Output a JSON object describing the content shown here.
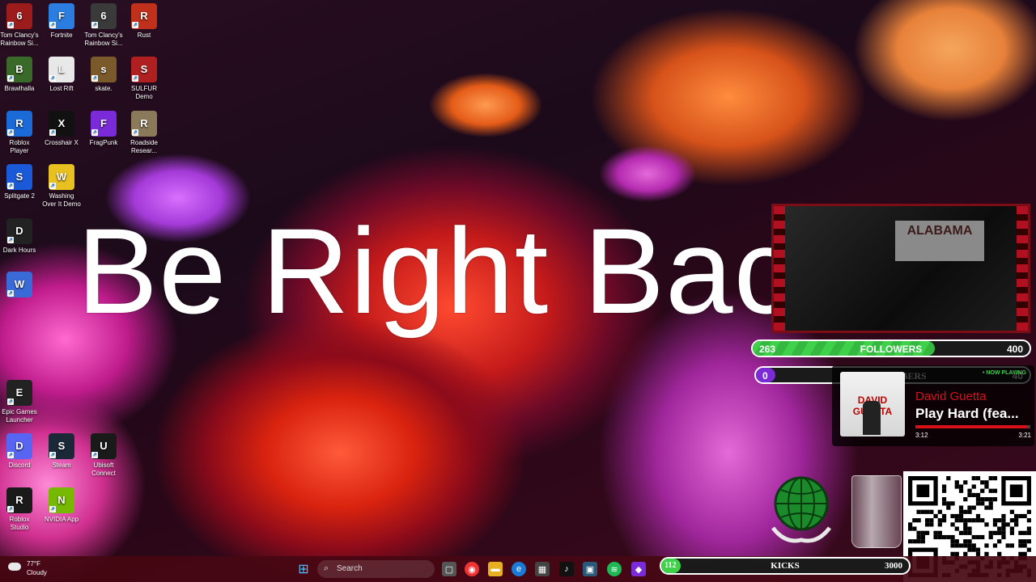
{
  "desktop_icons": [
    {
      "label": "Tom Clancy's Rainbow Si...",
      "glyph": "6",
      "color": "#9c1b1b",
      "icon": "rainbow-six-icon"
    },
    {
      "label": "Fortnite",
      "glyph": "F",
      "color": "#2b7de0",
      "icon": "fortnite-icon"
    },
    {
      "label": "Tom Clancy's Rainbow Si...",
      "glyph": "6",
      "color": "#3a3a3a",
      "icon": "rainbow-six-icon"
    },
    {
      "label": "Rust",
      "glyph": "R",
      "color": "#c0301a",
      "icon": "rust-icon"
    },
    {
      "label": "Brawlhalla",
      "glyph": "B",
      "color": "#3a6a2a",
      "icon": "brawlhalla-icon"
    },
    {
      "label": "Lost Rift",
      "glyph": "L",
      "color": "#e8e8e8",
      "icon": "lost-rift-icon"
    },
    {
      "label": "skate.",
      "glyph": "s",
      "color": "#7a5a2a",
      "icon": "skate-icon"
    },
    {
      "label": "SULFUR Demo",
      "glyph": "S",
      "color": "#b02020",
      "icon": "sulfur-icon"
    },
    {
      "label": "Roblox Player",
      "glyph": "R",
      "color": "#1a6ad8",
      "icon": "roblox-icon"
    },
    {
      "label": "Crosshair X",
      "glyph": "X",
      "color": "#111111",
      "icon": "crosshair-icon"
    },
    {
      "label": "FragPunk",
      "glyph": "F",
      "color": "#7a2ad8",
      "icon": "fragpunk-icon"
    },
    {
      "label": "Roadside Resear...",
      "glyph": "R",
      "color": "#8a7a5a",
      "icon": "roadside-research-icon"
    },
    {
      "label": "Splitgate 2",
      "glyph": "S",
      "color": "#1a5ad8",
      "icon": "splitgate-icon"
    },
    {
      "label": "Washing Over It Demo",
      "glyph": "W",
      "color": "#e8c020",
      "icon": "washing-over-it-icon"
    },
    {
      "label": "Dark Hours",
      "glyph": "D",
      "color": "#222222",
      "icon": "dark-hours-icon"
    },
    {
      "label": "",
      "glyph": "W",
      "color": "#3a6ad8",
      "icon": "app-w-icon"
    },
    {
      "label": "Epic Games Launcher",
      "glyph": "E",
      "color": "#222222",
      "icon": "epic-games-icon"
    },
    {
      "label": "Discord",
      "glyph": "D",
      "color": "#5865f2",
      "icon": "discord-icon"
    },
    {
      "label": "Steam",
      "glyph": "S",
      "color": "#1b2838",
      "icon": "steam-icon"
    },
    {
      "label": "Ubisoft Connect",
      "glyph": "U",
      "color": "#1a1a1a",
      "icon": "ubisoft-icon"
    },
    {
      "label": "Roblox Studio",
      "glyph": "R",
      "color": "#1a1a1a",
      "icon": "roblox-studio-icon"
    },
    {
      "label": "NVIDIA App",
      "glyph": "N",
      "color": "#76b900",
      "icon": "nvidia-icon"
    }
  ],
  "overlay": {
    "title": "Be Right Back",
    "webcam_banner": "ALABAMA",
    "followers": {
      "label": "FOLLOWERS",
      "current": "263",
      "goal": "400"
    },
    "subscribers": {
      "label": "SUBSCRIBERS",
      "current": "0",
      "goal": "40"
    },
    "kicks": {
      "label": "KICKS",
      "current": "112",
      "goal": "3000"
    },
    "now_playing": {
      "label": "• NOW PLAYING",
      "artist": "David Guetta",
      "title": "Play Hard (fea...",
      "elapsed": "3:12",
      "duration": "3:21",
      "progress": 0.97,
      "album_art_text": "DAVID GUETTA"
    }
  },
  "taskbar": {
    "weather_temp": "77°F",
    "weather_desc": "Cloudy",
    "search_placeholder": "Search"
  },
  "colors": {
    "followers_fill": "#3fd14a",
    "subs_fill": "#7a2bd6",
    "brand_red": "#d8101a"
  }
}
